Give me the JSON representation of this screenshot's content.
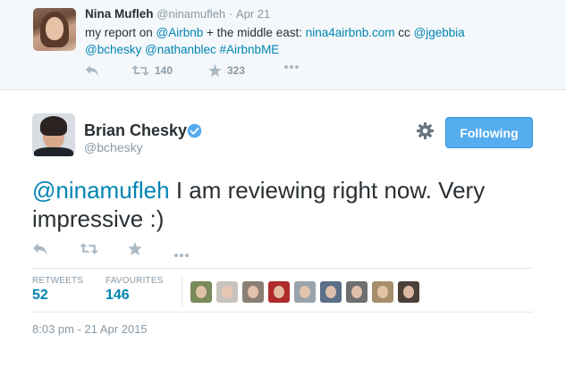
{
  "parent_tweet": {
    "name": "Nina Mufleh",
    "handle": "@ninamufleh",
    "separator": "·",
    "time": "Apr 21",
    "text_parts": {
      "t1": "my report on ",
      "l1": "@Airbnb",
      "t2": " + the middle east: ",
      "l2": "nina4airbnb.com",
      "t3": " cc ",
      "l3": "@jgebbia",
      "l4": "@bchesky",
      "t4": " ",
      "l5": "@nathanblec",
      "t5": " ",
      "l6": "#AirbnbME"
    },
    "retweet_count": "140",
    "favorite_count": "323"
  },
  "main_tweet": {
    "name": "Brian Chesky",
    "handle": "@bchesky",
    "follow_button": "Following",
    "text_mention": "@ninamufleh",
    "text_body": " I am reviewing right now. Very impressive :)",
    "retweets_label": "RETWEETS",
    "retweets_value": "52",
    "favourites_label": "FAVOURITES",
    "favourites_value": "146",
    "timestamp": "8:03 pm - 21 Apr 2015"
  },
  "colors": {
    "link": "#0084b4",
    "follow_button": "#55acee",
    "verified": "#55acee",
    "muted": "#8899a6",
    "icon": "#aab8c2"
  },
  "icons": [
    "reply-icon",
    "retweet-icon",
    "favorite-icon",
    "more-icon",
    "gear-icon",
    "verified-badge-icon"
  ]
}
